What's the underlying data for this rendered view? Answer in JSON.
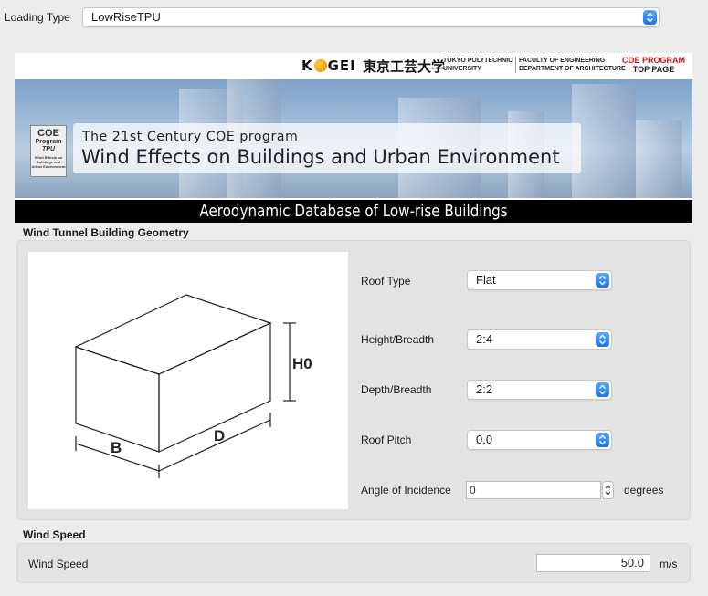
{
  "loading": {
    "label": "Loading Type",
    "value": "LowRiseTPU"
  },
  "banner": {
    "logo_text": "K  GEI",
    "kanji": "東京工芸大学",
    "university_line1": "TOKYO POLYTECHNIC",
    "university_line2": "UNIVERSITY",
    "faculty_line1": "FACULTY OF ENGINEERING",
    "faculty_line2": "DEPARTMENT OF ARCHITECTURE",
    "coe_link_line1": "COE PROGRAM",
    "coe_link_line2": "TOP PAGE",
    "badge_line1": "COE",
    "badge_line2": "Program",
    "badge_line3": "TPU",
    "badge_line4": "Wind Effects on Buildings and Urban Environment",
    "title_small": "The 21st Century COE program",
    "title_large": "Wind Effects on Buildings and Urban Environment",
    "subtitle_bar": "Aerodynamic Database of Low-rise Buildings"
  },
  "geometry": {
    "section_title": "Wind Tunnel Building Geometry",
    "figure_labels": {
      "h0": "H0",
      "b": "B",
      "d": "D"
    },
    "roof_type": {
      "label": "Roof Type",
      "value": "Flat"
    },
    "height_breadth": {
      "label": "Height/Breadth",
      "value": "2:4"
    },
    "depth_breadth": {
      "label": "Depth/Breadth",
      "value": "2:2"
    },
    "roof_pitch": {
      "label": "Roof Pitch",
      "value": "0.0"
    },
    "angle": {
      "label": "Angle of Incidence",
      "value": "0",
      "unit": "degrees"
    }
  },
  "wind": {
    "section_title": "Wind Speed",
    "label": "Wind Speed",
    "value": "50.0",
    "unit": "m/s"
  },
  "colors": {
    "accent": "#1c72e8",
    "bar": "#000000",
    "coe_red": "#d0101a"
  }
}
